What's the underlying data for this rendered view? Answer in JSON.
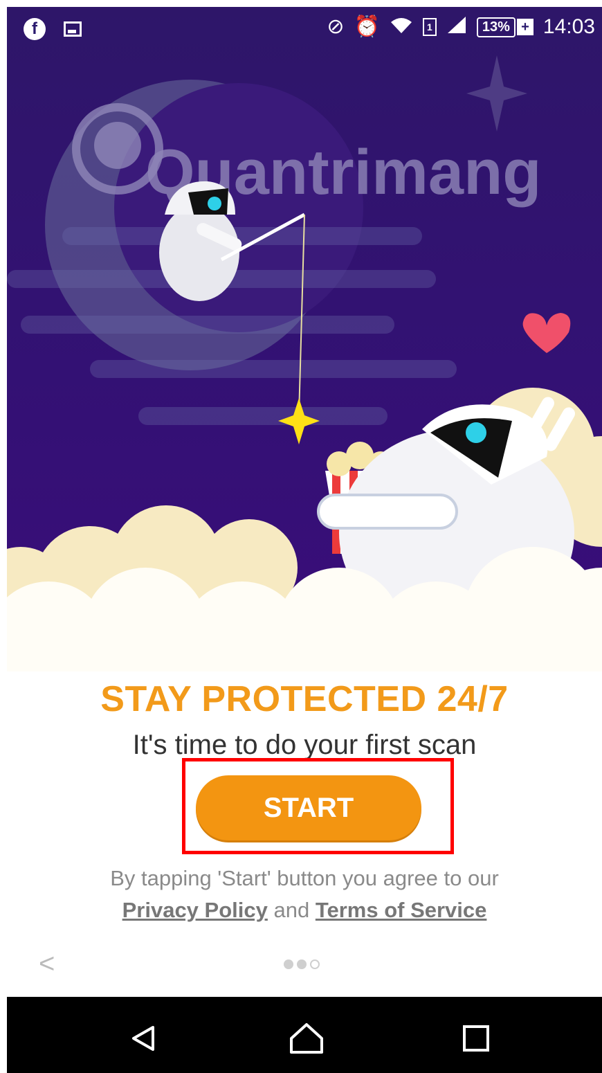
{
  "status_bar": {
    "time": "14:03",
    "battery": "13%",
    "sim": "1",
    "icons": [
      "facebook-icon",
      "image-icon",
      "do-not-disturb-icon",
      "alarm-icon",
      "wifi-icon",
      "sim-icon",
      "signal-icon",
      "battery-icon"
    ]
  },
  "hero": {
    "watermark": "Quantrimang"
  },
  "onboarding": {
    "title": "STAY PROTECTED 24/7",
    "subtitle": "It's time to do your first scan",
    "start_label": "START",
    "legal_prefix": "By tapping 'Start' button you agree to our",
    "privacy_label": "Privacy Policy",
    "and_label": "and",
    "terms_label": "Terms of Service",
    "page_indicator": {
      "total": 3,
      "current": 2
    }
  },
  "colors": {
    "accent": "#f39511",
    "title": "#f29a1a",
    "hero_bg": "#331174",
    "highlight": "#ff0000"
  },
  "nav_bar": {
    "icons": [
      "back-icon",
      "home-icon",
      "recents-icon"
    ]
  }
}
